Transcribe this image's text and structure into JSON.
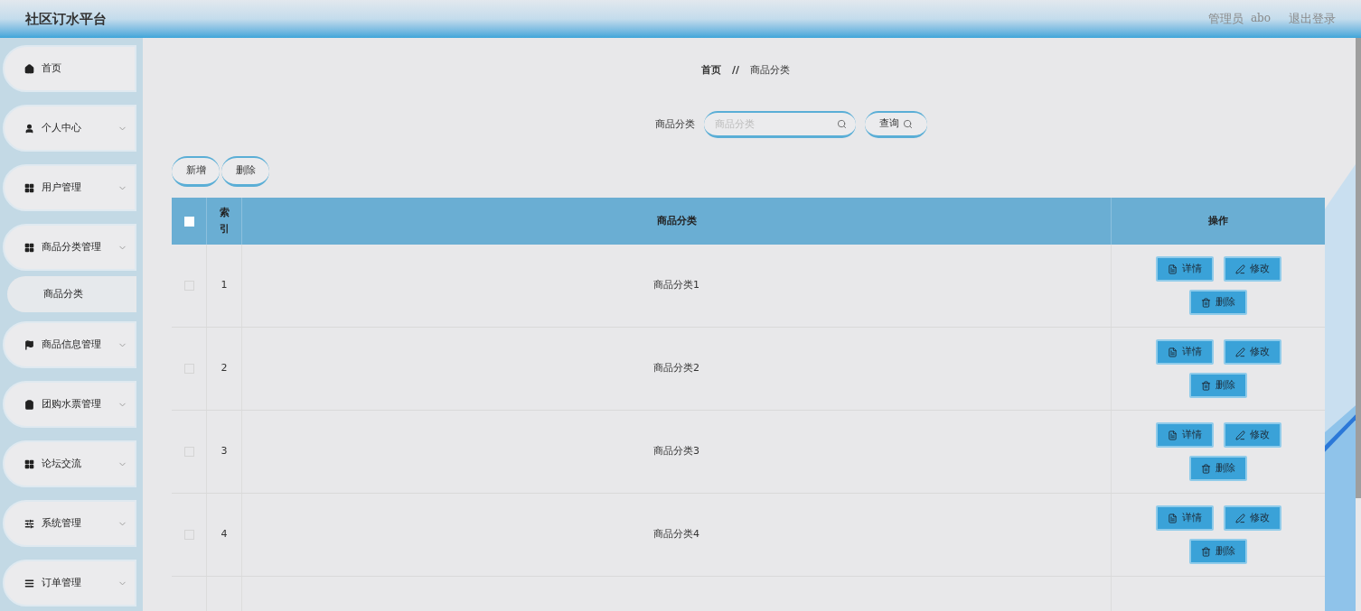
{
  "header": {
    "title": "社区订水平台",
    "user_role": "管理员",
    "user_name": "abo",
    "logout": "退出登录"
  },
  "sidebar": {
    "items": [
      {
        "label": "首页",
        "has_submenu": false
      },
      {
        "label": "个人中心",
        "has_submenu": true
      },
      {
        "label": "用户管理",
        "has_submenu": true
      },
      {
        "label": "商品分类管理",
        "has_submenu": true,
        "children": [
          {
            "label": "商品分类",
            "selected": true
          }
        ]
      },
      {
        "label": "商品信息管理",
        "has_submenu": true
      },
      {
        "label": "团购水票管理",
        "has_submenu": true
      },
      {
        "label": "论坛交流",
        "has_submenu": true
      },
      {
        "label": "系统管理",
        "has_submenu": true
      },
      {
        "label": "订单管理",
        "has_submenu": true
      }
    ]
  },
  "breadcrumb": {
    "home": "首页",
    "separator": "//",
    "current": "商品分类"
  },
  "search": {
    "label": "商品分类",
    "placeholder": "商品分类",
    "button": "查询"
  },
  "actions": [
    "新增",
    "删除"
  ],
  "table": {
    "columns": [
      "索引",
      "商品分类",
      "操作"
    ],
    "rows": [
      {
        "checked": false,
        "index": "1",
        "name": "商品分类1",
        "buttons": [
          "详情",
          "修改",
          "删除"
        ]
      },
      {
        "checked": false,
        "index": "2",
        "name": "商品分类2",
        "buttons": [
          "详情",
          "修改",
          "删除"
        ]
      },
      {
        "checked": false,
        "index": "3",
        "name": "商品分类3",
        "buttons": [
          "详情",
          "修改",
          "删除"
        ]
      },
      {
        "checked": false,
        "index": "4",
        "name": "商品分类4",
        "buttons": [
          "详情",
          "修改",
          "删除"
        ]
      }
    ],
    "header_checked": false
  }
}
